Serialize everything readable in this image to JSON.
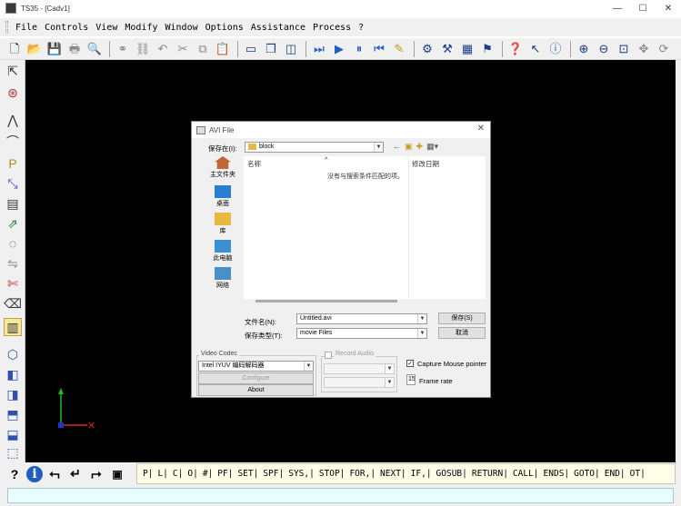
{
  "window": {
    "title": "TS35 - [Cadv1]",
    "minimize": "—",
    "maximize": "☐",
    "close": "✕"
  },
  "menu": [
    "File",
    "Controls",
    "View",
    "Modify",
    "Window",
    "Options",
    "Assistance",
    "Process",
    "?"
  ],
  "command_bar": {
    "help": "?",
    "info": "i",
    "commands": [
      "P|",
      "L|",
      "C|",
      "O|",
      "#|",
      "PF|",
      "SET|",
      "SPF|",
      "SYS,|",
      "STOP|",
      "FOR,|",
      "NEXT|",
      "IF,|",
      "GOSUB|",
      "RETURN|",
      "CALL|",
      "ENDS|",
      "GOTO|",
      "END|",
      "OT|"
    ]
  },
  "dialog": {
    "title": "AVI File",
    "close": "✕",
    "save_in_label": "保存在(I):",
    "save_in_value": "block",
    "places": [
      "主文件夹",
      "桌面",
      "库",
      "此电脑",
      "网络"
    ],
    "columns": [
      "名称",
      "修改日期"
    ],
    "sort_indicator": "^",
    "empty_message": "没有与搜索条件匹配的项。",
    "filename_label": "文件名(N):",
    "filename_value": "Untitled.avi",
    "filetype_label": "保存类型(T):",
    "filetype_value": "movie Files",
    "save_button": "保存(S)",
    "cancel_button": "取消",
    "video_codec": {
      "label": "Video Codec",
      "value": "Intel IYUV 编码解码器",
      "configure": "Configure",
      "about": "About"
    },
    "record_audio": {
      "label": "Record Audio",
      "checked": false
    },
    "capture_mouse": {
      "label": "Capture Mouse pointer",
      "checked": true
    },
    "frame_rate": {
      "value": "15",
      "label": "Frame rate"
    }
  },
  "colors": {
    "canvas": "#000000",
    "axis_y": "#22bb22",
    "axis_x": "#dd2222",
    "axis_origin": "#2233cc",
    "command_strip": "#fdfde8",
    "status_input": "#e8ffff"
  }
}
